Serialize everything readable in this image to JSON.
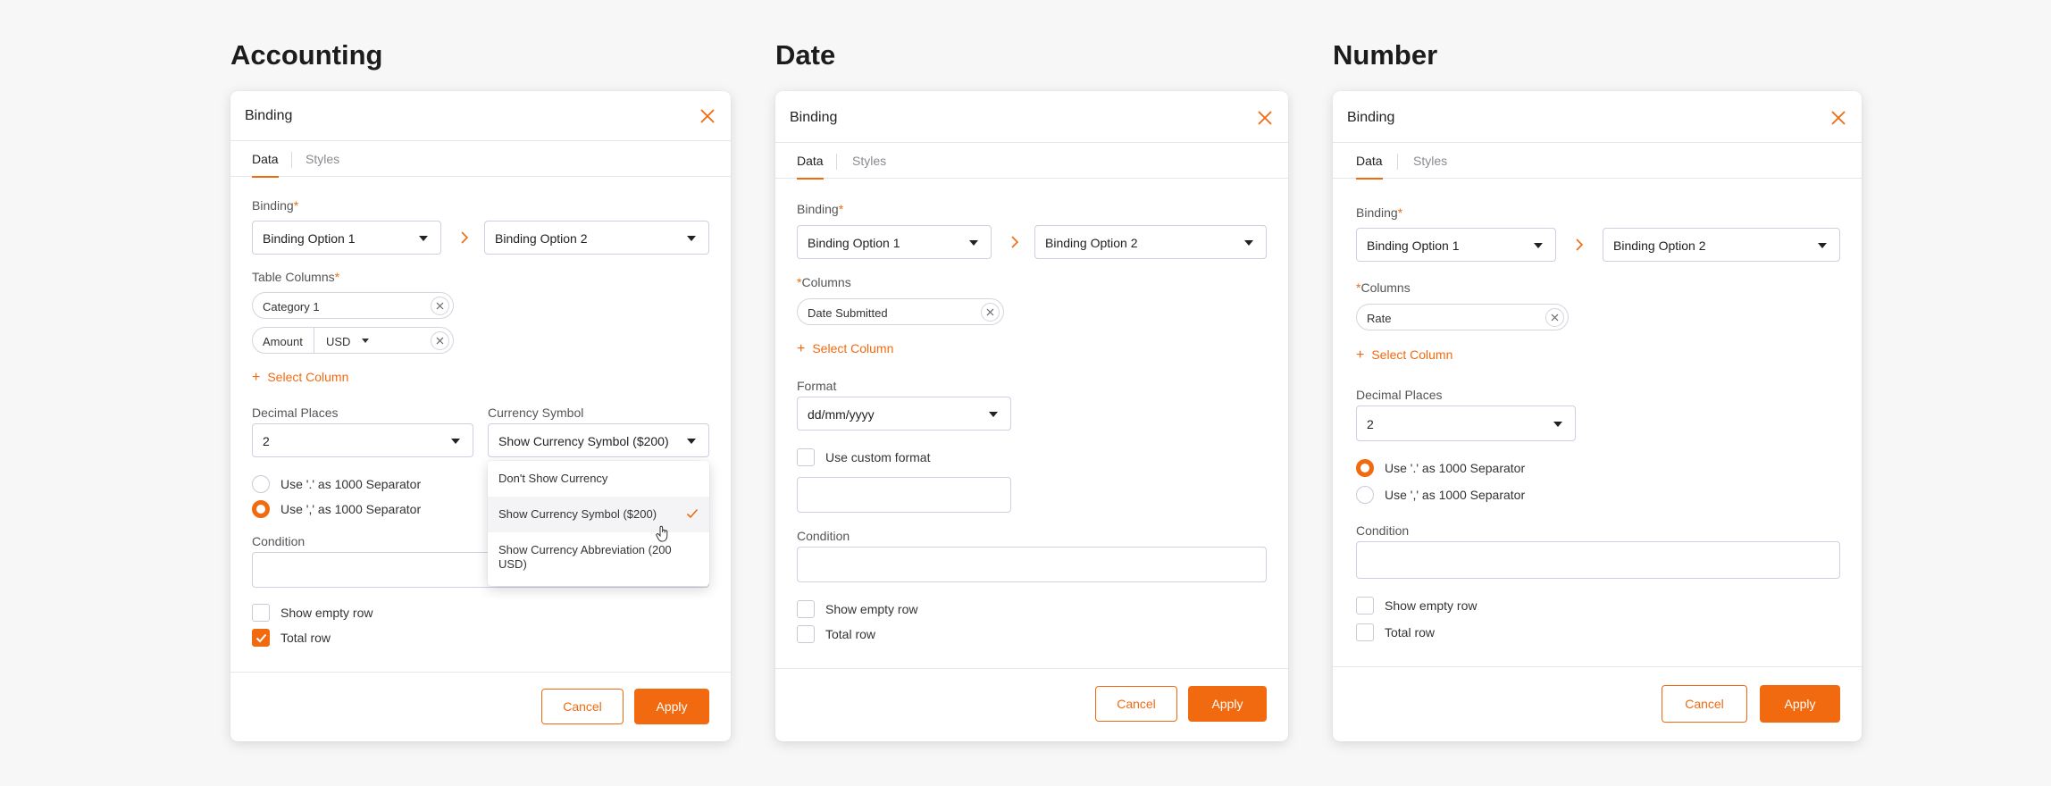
{
  "colors": {
    "accent": "#f26a0f",
    "border": "#cfcfe0",
    "background": "#f7f7f8"
  },
  "sections": {
    "accounting": {
      "title": "Accounting"
    },
    "date": {
      "title": "Date"
    },
    "number": {
      "title": "Number"
    }
  },
  "common": {
    "dialog_title": "Binding",
    "tab_data": "Data",
    "tab_styles": "Styles",
    "binding_label": "Binding",
    "binding_option_1": "Binding Option 1",
    "binding_option_2": "Binding Option 2",
    "select_column": "Select Column",
    "condition_label": "Condition",
    "show_empty_row": "Show empty row",
    "total_row": "Total row",
    "cancel": "Cancel",
    "apply": "Apply",
    "decimal_places_label": "Decimal Places",
    "decimal_places_value": "2",
    "sep_dot": "Use '.' as 1000 Separator",
    "sep_comma": "Use ',' as 1000 Separator",
    "columns_label": "Columns",
    "required_mark": "*",
    "plus": "+"
  },
  "accounting": {
    "table_columns_label": "Table Columns",
    "chip_category": "Category 1",
    "chip_amount": "Amount",
    "chip_currency": "USD",
    "currency_symbol_label": "Currency Symbol",
    "currency_symbol_value": "Show Currency Symbol ($200)",
    "selected_separator": "comma",
    "total_row_checked": true,
    "show_empty_row_checked": false,
    "menu_options": [
      "Don't Show Currency",
      "Show Currency Symbol ($200)",
      "Show Currency Abbreviation (200 USD)"
    ],
    "menu_selected_index": 1
  },
  "date": {
    "chip_column": "Date Submitted",
    "format_label": "Format",
    "format_value": "dd/mm/yyyy",
    "custom_format_label": "Use custom format",
    "custom_format_checked": false,
    "show_empty_row_checked": false,
    "total_row_checked": false
  },
  "number": {
    "chip_column": "Rate",
    "selected_separator": "dot",
    "show_empty_row_checked": false,
    "total_row_checked": false
  }
}
